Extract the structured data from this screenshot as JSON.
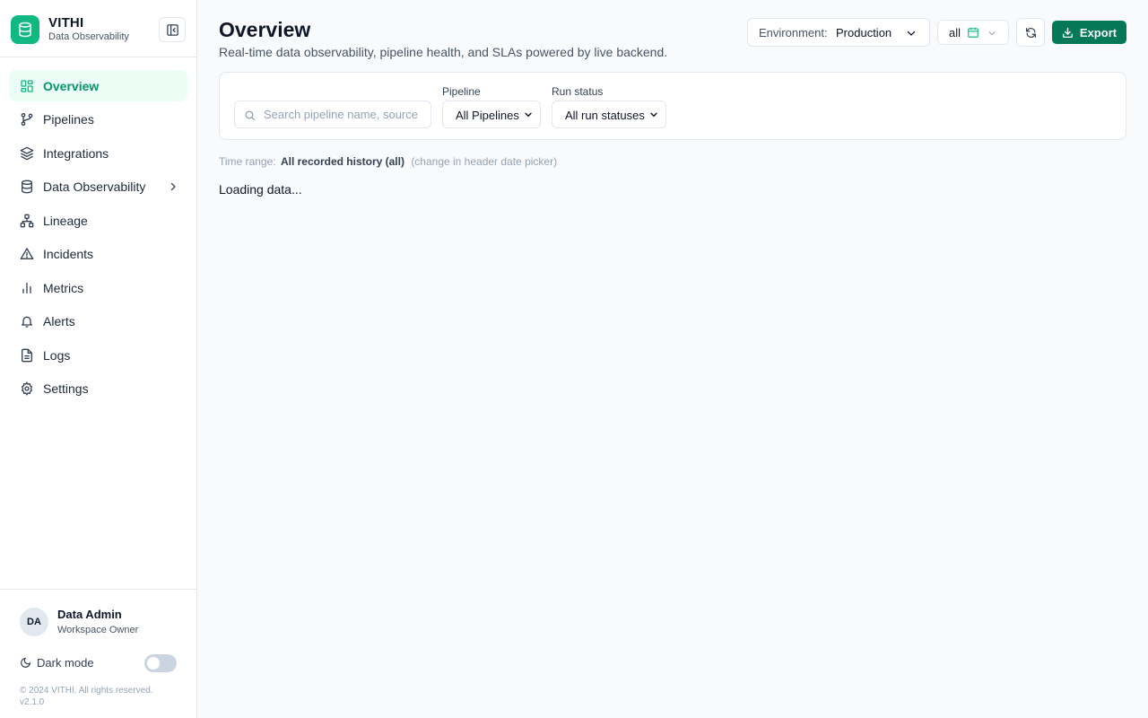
{
  "brand": {
    "name": "VITHI",
    "subtitle": "Data Observability"
  },
  "nav": {
    "items": [
      {
        "label": "Overview",
        "icon": "grid-icon",
        "active": true
      },
      {
        "label": "Pipelines",
        "icon": "git-branch-icon"
      },
      {
        "label": "Integrations",
        "icon": "layers-icon"
      },
      {
        "label": "Data Observability",
        "icon": "database-icon",
        "has_submenu": true
      },
      {
        "label": "Lineage",
        "icon": "network-icon"
      },
      {
        "label": "Incidents",
        "icon": "alert-triangle-icon"
      },
      {
        "label": "Metrics",
        "icon": "bar-chart-icon"
      },
      {
        "label": "Alerts",
        "icon": "bell-icon"
      },
      {
        "label": "Logs",
        "icon": "file-text-icon"
      },
      {
        "label": "Settings",
        "icon": "gear-icon"
      }
    ]
  },
  "user": {
    "initials": "DA",
    "name": "Data Admin",
    "role": "Workspace Owner"
  },
  "dark_mode": {
    "label": "Dark mode",
    "enabled": false
  },
  "footer": {
    "copyright": "© 2024 VITHI. All rights reserved.",
    "version": "v2.1.0"
  },
  "header": {
    "title": "Overview",
    "subtitle": "Real-time data observability, pipeline health, and SLAs powered by live backend.",
    "environment_label": "Environment:",
    "environment_value": "Production",
    "date_range": "all",
    "export_label": "Export"
  },
  "filters": {
    "search_placeholder": "Search pipeline name, source",
    "pipeline_label": "Pipeline",
    "pipeline_value": "All Pipelines",
    "status_label": "Run status",
    "status_value": "All run statuses"
  },
  "time_range": {
    "prefix": "Time range:",
    "value": "All recorded history (all)",
    "hint": "(change in header date picker)"
  },
  "loading_text": "Loading data...",
  "colors": {
    "accent": "#10b981",
    "export": "#047857",
    "active_bg": "#ecfdf5"
  }
}
